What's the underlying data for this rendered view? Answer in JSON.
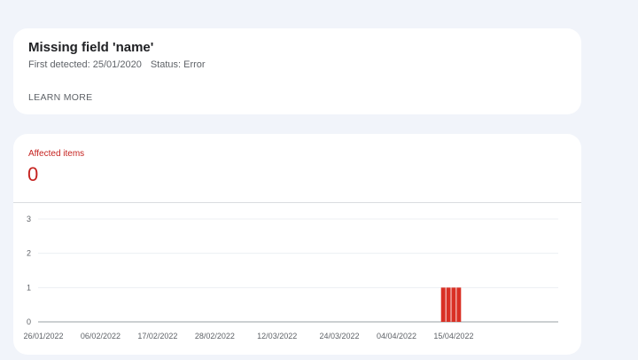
{
  "issue": {
    "title": "Missing field 'name'",
    "first_detected": "First detected: 25/01/2020",
    "status": "Status: Error",
    "learn_more": "LEARN MORE"
  },
  "metric": {
    "label": "Affected items",
    "value": "0"
  },
  "colors": {
    "accent": "#c5221f",
    "bar": "#d93025"
  },
  "chart_data": {
    "type": "bar",
    "x_ticks": [
      "26/01/2022",
      "06/02/2022",
      "17/02/2022",
      "28/02/2022",
      "12/03/2022",
      "24/03/2022",
      "04/04/2022",
      "15/04/2022"
    ],
    "y_ticks": [
      0,
      1,
      2,
      3
    ],
    "ylim": [
      0,
      3
    ],
    "bars": [
      {
        "date": "13/04/2022",
        "value": 1
      },
      {
        "date": "14/04/2022",
        "value": 1
      },
      {
        "date": "15/04/2022",
        "value": 1
      },
      {
        "date": "16/04/2022",
        "value": 1
      }
    ],
    "grid": true
  }
}
